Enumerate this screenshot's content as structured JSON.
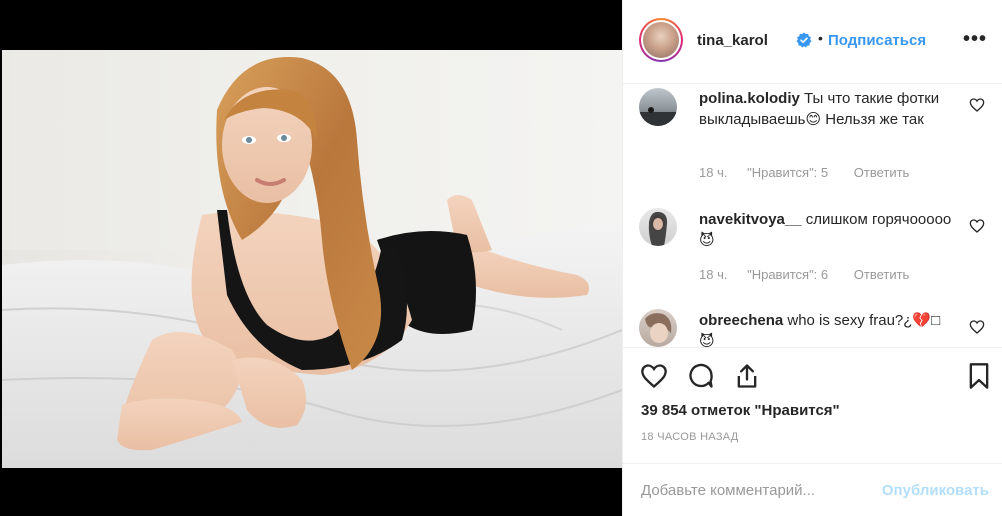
{
  "post": {
    "username": "tina_karol",
    "separator": "•",
    "follow_label": "Подписаться",
    "more_icon": "more-options-icon",
    "more_label": "•••"
  },
  "comments": [
    {
      "username": "polina.kolodiy",
      "text": "Ты что такие фотки выкладываешь😊 Нельзя же так",
      "time": "18 ч.",
      "likes": "\"Нравится\": 5",
      "reply": "Ответить"
    },
    {
      "username": "navekitvoya__",
      "text": "слишком горячооооо😈",
      "time": "18 ч.",
      "likes": "\"Нравится\": 6",
      "reply": "Ответить"
    },
    {
      "username": "obreechena",
      "text": "who is sexy frau?¿💔□ 😈"
    }
  ],
  "actions": {
    "likes_count": "39 854 отметок \"Нравится\"",
    "time_ago": "18 ЧАСОВ НАЗАД"
  },
  "composer": {
    "placeholder": "Добавьте комментарий...",
    "publish_label": "Опубликовать"
  },
  "colors": {
    "accent": "#3897f0",
    "publish_disabled": "#b2dffc",
    "muted": "#999999"
  }
}
